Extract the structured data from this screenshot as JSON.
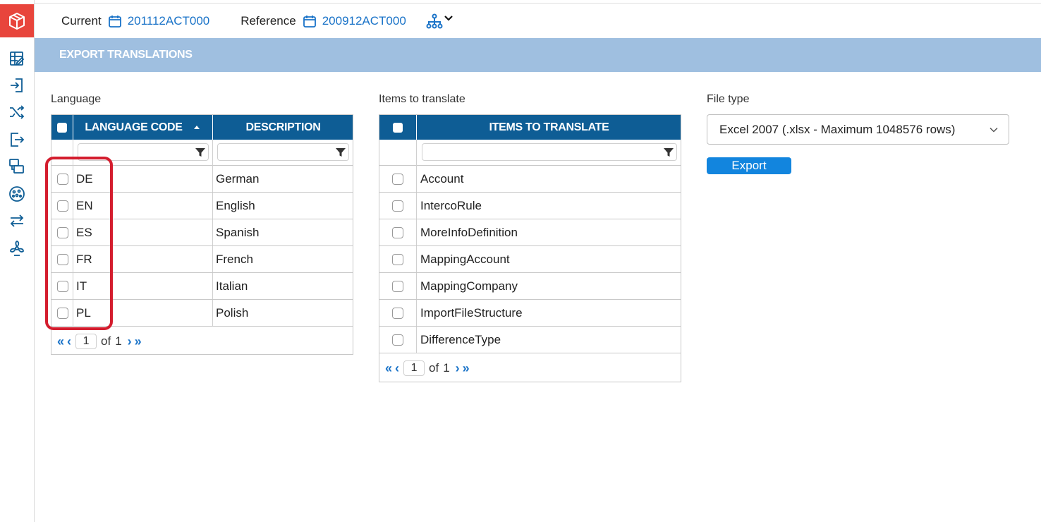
{
  "header": {
    "current_label": "Current",
    "current_value": "201112ACT000",
    "reference_label": "Reference",
    "reference_value": "200912ACT000"
  },
  "banner": {
    "title": "EXPORT TRANSLATIONS"
  },
  "colors": {
    "brand": "#e8453c",
    "header_blue": "#0e5d95",
    "banner": "#9fbfe0",
    "link": "#1a73c8",
    "button": "#1285de",
    "highlight": "#d41d2e"
  },
  "sidebar": {
    "icons": [
      "grid-edit-icon",
      "login-icon",
      "shuffle-icon",
      "logout-icon",
      "layers-icon",
      "globe-icon",
      "swap-icon",
      "fan-icon"
    ]
  },
  "language": {
    "section_label": "Language",
    "columns": [
      "LANGUAGE CODE",
      "DESCRIPTION"
    ],
    "sort": "ascending",
    "rows": [
      {
        "code": "DE",
        "description": "German"
      },
      {
        "code": "EN",
        "description": "English"
      },
      {
        "code": "ES",
        "description": "Spanish"
      },
      {
        "code": "FR",
        "description": "French"
      },
      {
        "code": "IT",
        "description": "Italian"
      },
      {
        "code": "PL",
        "description": "Polish"
      }
    ],
    "pager": {
      "page": "1",
      "of_label": "of",
      "total": "1"
    }
  },
  "items": {
    "section_label": "Items to translate",
    "column": "ITEMS TO TRANSLATE",
    "rows": [
      "Account",
      "IntercoRule",
      "MoreInfoDefinition",
      "MappingAccount",
      "MappingCompany",
      "ImportFileStructure",
      "DifferenceType"
    ],
    "pager": {
      "page": "1",
      "of_label": "of",
      "total": "1"
    }
  },
  "file_type": {
    "section_label": "File type",
    "selected": "Excel 2007 (.xlsx - Maximum 1048576 rows)",
    "export_label": "Export"
  }
}
